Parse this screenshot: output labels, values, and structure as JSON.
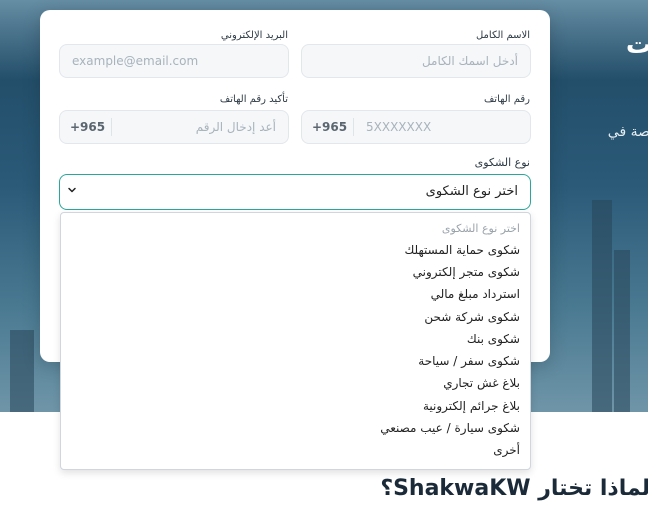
{
  "hero": {
    "title": "ت",
    "subtitle": "صة في"
  },
  "form": {
    "full_name": {
      "label": "الاسم الكامل",
      "placeholder": "أدخل اسمك الكامل"
    },
    "email": {
      "label": "البريد الإلكتروني",
      "placeholder": "example@email.com"
    },
    "phone": {
      "label": "رقم الهاتف",
      "country_code": "+965",
      "placeholder": "5XXXXXXX"
    },
    "confirm_phone": {
      "label": "تأكيد رقم الهاتف",
      "country_code": "+965",
      "placeholder": "أعد إدخال الرقم"
    },
    "complaint_type": {
      "label": "نوع الشكوى",
      "selected": "اختر نوع الشكوى"
    }
  },
  "dropdown": {
    "options": [
      "اختر نوع الشكوى",
      "شكوى حماية المستهلك",
      "شكوى متجر إلكتروني",
      "استرداد مبلغ مالي",
      "شكوى شركة شحن",
      "شكوى بنك",
      "شكوى سفر / سياحة",
      "بلاغ غش تجاري",
      "بلاغ جرائم إلكترونية",
      "شكوى سيارة / عيب مصنعي",
      "أخرى"
    ]
  },
  "section": {
    "title": "لماذا تختار ShakwaKW؟"
  },
  "colors": {
    "accent": "#2aa79b",
    "hero_bg": "#2a5a78"
  }
}
